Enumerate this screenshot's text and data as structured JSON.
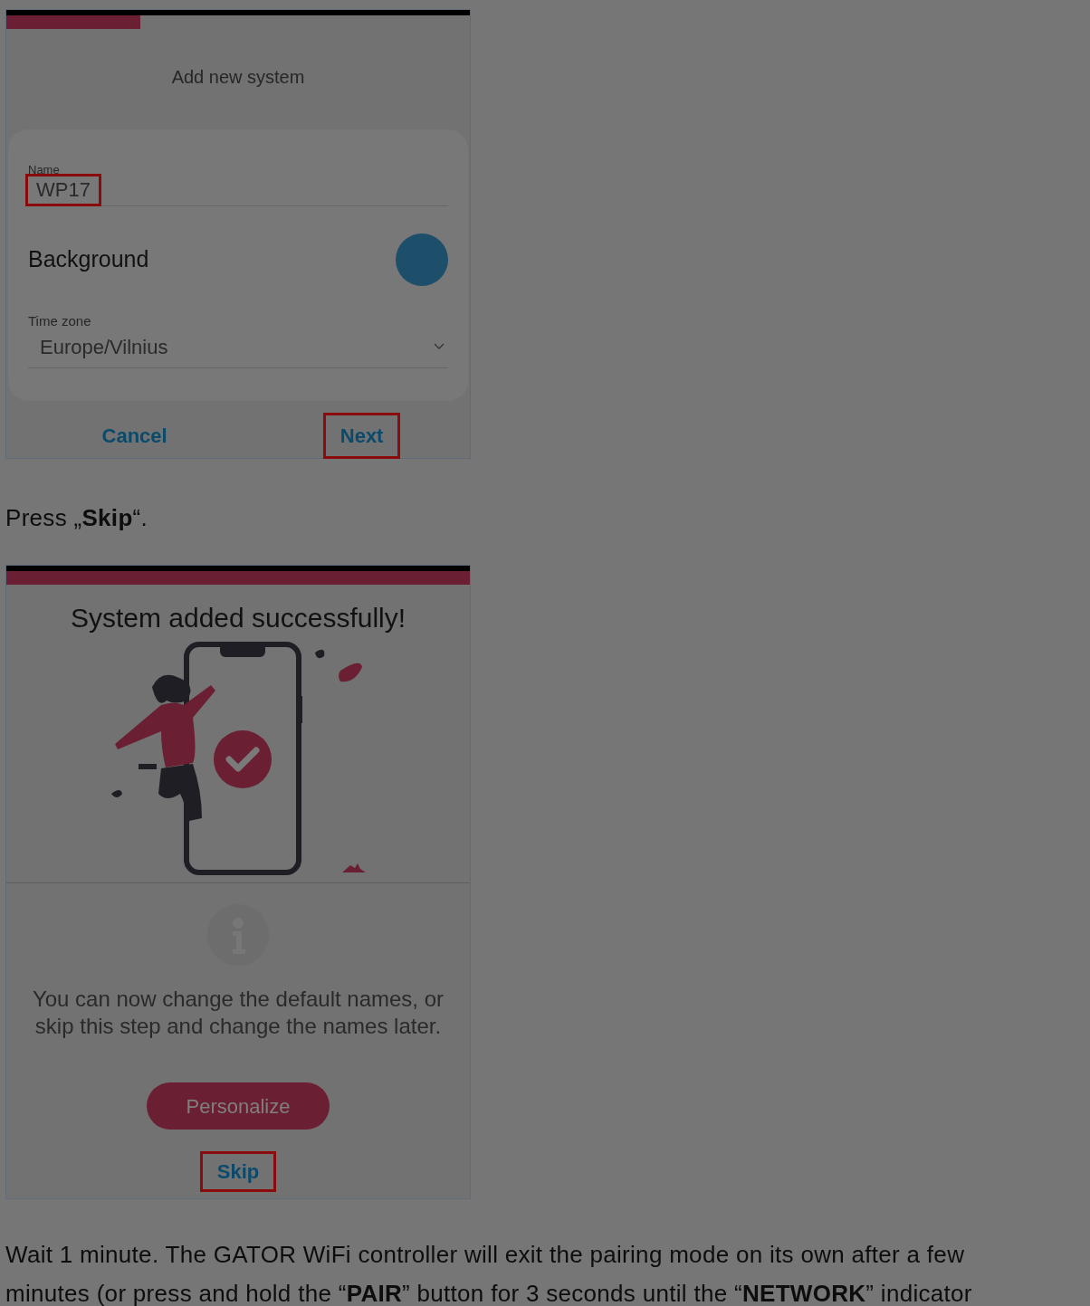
{
  "blocks": [
    {
      "kind": "form_screen",
      "progress": {
        "level": 0.29
      },
      "title": "Add new system",
      "fields": [
        {
          "kind": "text",
          "label": "Name",
          "value": "WP17",
          "highlighted": true
        },
        {
          "kind": "swatch",
          "label": "Background",
          "color": "#1d4e6a"
        },
        {
          "kind": "select",
          "label": "Time zone",
          "value": "Europe/Vilnius"
        }
      ],
      "buttons": [
        {
          "label": "Cancel",
          "highlighted": false
        },
        {
          "label": "Next",
          "highlighted": true
        }
      ]
    },
    {
      "kind": "paragraph",
      "lines": [
        "Press „**Skip**“."
      ]
    },
    {
      "kind": "success_screen",
      "progress": {
        "level": 1
      },
      "title": "System added successfully!",
      "message": "You can now change the default names, or skip this step and change the names later.",
      "primary": {
        "label": "Personalize",
        "highlighted": false
      },
      "secondary": {
        "label": "Skip",
        "highlighted": true
      }
    },
    {
      "kind": "paragraph",
      "lines": [
        "Wait 1 minute. The GATOR WiFi controller will exit the pairing mode on its own after a few",
        "minutes (or press and hold the “**PAIR**” button for 3 seconds until the “**NETWORK**” indicator"
      ]
    }
  ]
}
